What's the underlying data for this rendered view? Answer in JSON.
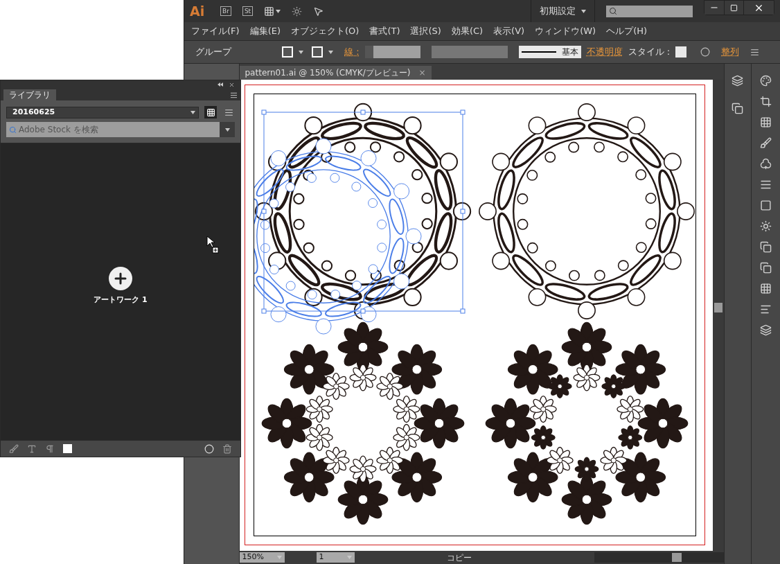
{
  "app": {
    "logo": "Ai",
    "bridge": "Br",
    "stock": "St",
    "workspace": "初期設定"
  },
  "menus": [
    "ファイル(F)",
    "編集(E)",
    "オブジェクト(O)",
    "書式(T)",
    "選択(S)",
    "効果(C)",
    "表示(V)",
    "ウィンドウ(W)",
    "ヘルプ(H)"
  ],
  "control_bar": {
    "selection": "グループ",
    "stroke_label": "線 :",
    "stroke_profile": "基本",
    "opacity": "不透明度",
    "style_label": "スタイル :",
    "align": "整列"
  },
  "document_tab": {
    "title": "pattern01.ai @ 150% (CMYK/プレビュー)",
    "close": "×"
  },
  "status_bar": {
    "zoom": "150%",
    "artboard": "1",
    "status": "コピー"
  },
  "library": {
    "tab": "ライブラリ",
    "library_name": "20160625",
    "view_modes": [
      {
        "kind": "grid",
        "selected": true
      },
      {
        "kind": "list",
        "selected": false
      }
    ],
    "search_placeholder": "Adobe Stock を検索",
    "drop_item": "アートワーク 1"
  }
}
